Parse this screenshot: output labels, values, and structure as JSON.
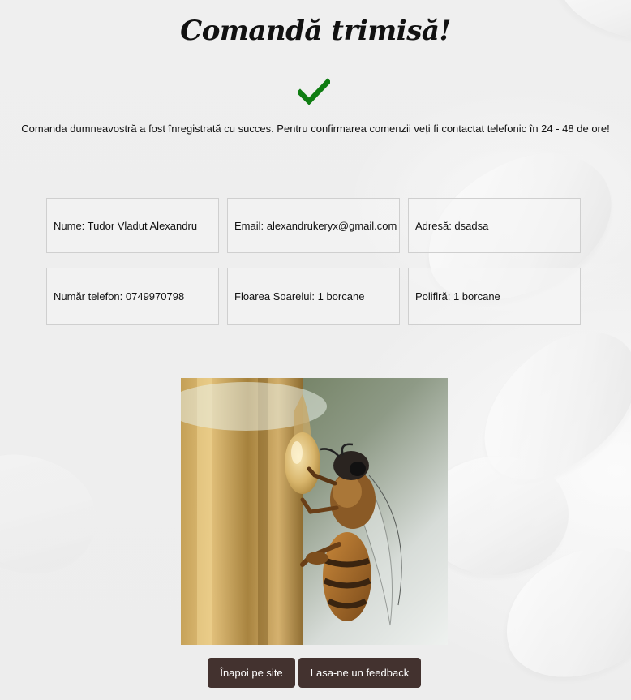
{
  "page": {
    "title": "Comandă trimisă!",
    "message": "Comanda dumneavostră a fost înregistrată cu succes. Pentru confirmarea comenzii veți fi contactat telefonic în 24 - 48 de ore!"
  },
  "order": {
    "row1": [
      "Nume: Tudor Vladut Alexandru",
      "Email: alexandrukeryx@gmail.com",
      "Adresă: dsadsa"
    ],
    "row2": [
      "Număr telefon: 0749970798",
      "Floarea Soarelui: 1 borcane",
      "Poliflră: 1 borcane"
    ]
  },
  "buttons": {
    "back": "Înapoi pe site",
    "feedback": "Lasa-ne un feedback"
  },
  "icons": {
    "success": "check-icon"
  },
  "colors": {
    "check": "#0f7d12",
    "button_bg": "#43322f",
    "button_text": "#ffffff",
    "card_border": "#cfcfcf"
  }
}
